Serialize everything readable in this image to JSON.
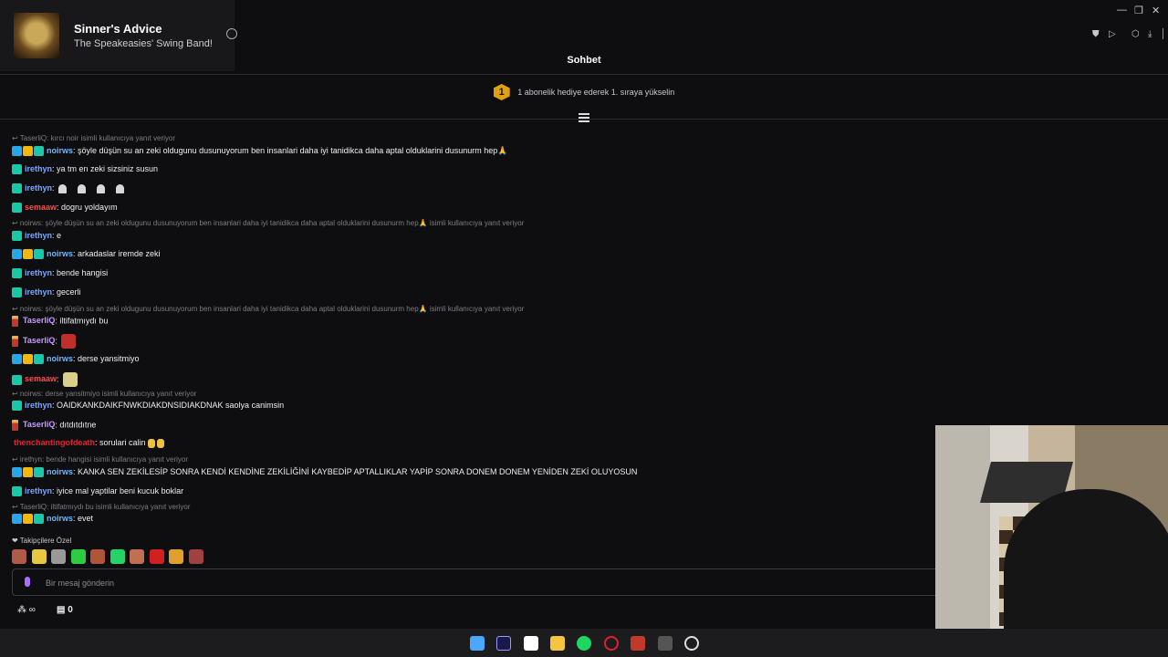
{
  "now_playing": {
    "title": "Sinner's Advice",
    "artist": "The Speakeasies' Swing Band!"
  },
  "window": {
    "minimize": "—",
    "restore": "❐",
    "close": "✕"
  },
  "chat": {
    "title": "Sohbet",
    "gift_rank": "1",
    "gift_text": "1 abonelik hediye ederek 1. sıraya yükselin",
    "messages": [
      {
        "type": "reply",
        "text": "TaserliQ: kırcı noir isimli kullanıcıya yanıt veriyor"
      },
      {
        "type": "msg",
        "badges": [
          "pred",
          "crown",
          "sub"
        ],
        "user": "noirws",
        "color": "#6fb6ff",
        "text": ": şöyle düşün su an zeki oldugunu dusunuyorum ben insanlari daha iyi tanidikca daha aptal olduklarini dusunurm hep🙏"
      },
      {
        "type": "msg",
        "badges": [
          "sub"
        ],
        "user": "irethyn",
        "color": "#7aa7ff",
        "text": ": ya tm en zeki sizsiniz susun"
      },
      {
        "type": "msg",
        "badges": [
          "sub"
        ],
        "user": "irethyn",
        "color": "#7aa7ff",
        "text": ":",
        "ghosts": 4
      },
      {
        "type": "msg",
        "badges": [
          "sub"
        ],
        "user": "semaaw",
        "color": "#ff4b4b",
        "text": ": dogru yoldayım"
      },
      {
        "type": "reply",
        "text": "noirws: şöyle düşün su an zeki oldugunu dusunuyorum ben insanlari daha iyi tanidikca daha aptal olduklarini dusunurm hep🙏 isimli kullanıcıya yanıt veriyor"
      },
      {
        "type": "msg",
        "badges": [
          "sub"
        ],
        "user": "irethyn",
        "color": "#7aa7ff",
        "text": ": e"
      },
      {
        "type": "msg",
        "badges": [
          "pred",
          "crown",
          "sub"
        ],
        "user": "noirws",
        "color": "#6fb6ff",
        "text": ": arkadaslar iremde zeki"
      },
      {
        "type": "msg",
        "badges": [
          "sub"
        ],
        "user": "irethyn",
        "color": "#7aa7ff",
        "text": ": bende hangisi"
      },
      {
        "type": "msg",
        "badges": [
          "sub"
        ],
        "user": "irethyn",
        "color": "#7aa7ff",
        "text": ": gecerli"
      },
      {
        "type": "reply",
        "text": "noirws: şöyle düşün su an zeki oldugunu dusunuyorum ben insanlari daha iyi tanidikca daha aptal olduklarini dusunurm hep🙏 isimli kullanıcıya yanıt veriyor"
      },
      {
        "type": "msg",
        "badges": [
          "candle"
        ],
        "user": "TaserliQ",
        "color": "#c79bff",
        "text": ": iltifatmıydı bu"
      },
      {
        "type": "msg",
        "badges": [
          "candle"
        ],
        "user": "TaserliQ",
        "color": "#c79bff",
        "text": ":",
        "emote": "#c0302a"
      },
      {
        "type": "msg",
        "badges": [
          "pred",
          "crown",
          "sub"
        ],
        "user": "noirws",
        "color": "#6fb6ff",
        "text": ": derse yansitmiyo"
      },
      {
        "type": "msg",
        "badges": [
          "sub"
        ],
        "user": "semaaw",
        "color": "#ff4b4b",
        "text": ":",
        "emote": "#d9cf8a"
      },
      {
        "type": "reply",
        "text": "noirws: derse yansitmiyo isimli kullanıcıya yanıt veriyor"
      },
      {
        "type": "msg",
        "badges": [
          "sub"
        ],
        "user": "irethyn",
        "color": "#7aa7ff",
        "text": ": OAIDKANKDAIKFNWKDIAKDNSIDIAKDNAK saolya canimsin"
      },
      {
        "type": "msg",
        "badges": [
          "candle"
        ],
        "user": "TaserliQ",
        "color": "#c79bff",
        "text": ": dıtdıtdıtne"
      },
      {
        "type": "msg",
        "badges": [],
        "user": "thenchantingofdeath",
        "color": "#e0242f",
        "text": ": sorulari calin",
        "claps": 2
      },
      {
        "type": "reply",
        "text": "irethyn: bende hangisi isimli kullanıcıya yanıt veriyor"
      },
      {
        "type": "msg",
        "badges": [
          "pred",
          "crown",
          "sub"
        ],
        "user": "noirws",
        "color": "#6fb6ff",
        "text": ": KANKA SEN ZEKİLESİP SONRA KENDİ KENDİNE ZEKİLİĞİNİ KAYBEDİP APTALLIKLAR YAPİP SONRA DONEM DONEM YENİDEN ZEKİ OLUYOSUN"
      },
      {
        "type": "msg",
        "badges": [
          "sub"
        ],
        "user": "irethyn",
        "color": "#7aa7ff",
        "text": ": iyice mal yaptilar beni kucuk boklar"
      },
      {
        "type": "reply",
        "text": "TaserliQ: iltifatmıydı bu isimli kullanıcıya yanıt veriyor"
      },
      {
        "type": "msg",
        "badges": [
          "pred",
          "crown",
          "sub"
        ],
        "user": "noirws",
        "color": "#6fb6ff",
        "text": ": evet"
      }
    ],
    "followers_label": "❤ Takipçilere Özel",
    "input_placeholder": "Bir mesaj gönderin",
    "points_symbol": "∞",
    "store_count": "0"
  },
  "taskbar": {
    "apps": [
      "windows-start",
      "premiere-pro",
      "capcut",
      "file-explorer",
      "spotify",
      "opera",
      "voicemeeter",
      "app",
      "obs"
    ]
  }
}
